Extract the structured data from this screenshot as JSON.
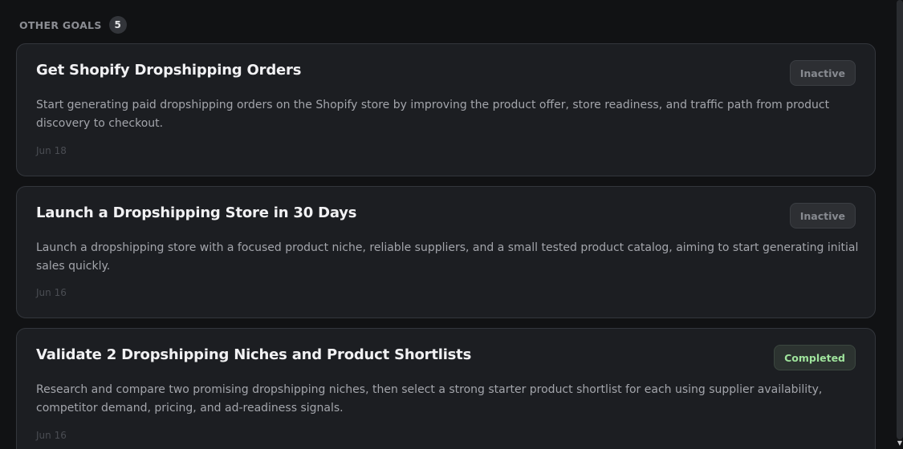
{
  "section": {
    "title": "OTHER GOALS",
    "count": "5"
  },
  "goals": [
    {
      "title": "Get Shopify Dropshipping Orders",
      "description": "Start generating paid dropshipping orders on the Shopify store by improving the product offer, store readiness, and traffic path from product discovery to checkout.",
      "date": "Jun 18",
      "status": "Inactive"
    },
    {
      "title": "Launch a Dropshipping Store in 30 Days",
      "description": "Launch a dropshipping store with a focused product niche, reliable suppliers, and a small tested product catalog, aiming to start generating initial sales quickly.",
      "date": "Jun 16",
      "status": "Inactive"
    },
    {
      "title": "Validate 2 Dropshipping Niches and Product Shortlists",
      "description": "Research and compare two promising dropshipping niches, then select a strong starter product shortlist for each using supplier availability, competitor demand, pricing, and ad-readiness signals.",
      "date": "Jun 16",
      "status": "Completed"
    }
  ],
  "colors": {
    "background": "#111214",
    "card": "#1c1e22",
    "completed_text": "#9fe49c",
    "inactive_text": "#878a90"
  },
  "icons": {
    "scroll_down": "scroll-down-arrow-icon"
  }
}
